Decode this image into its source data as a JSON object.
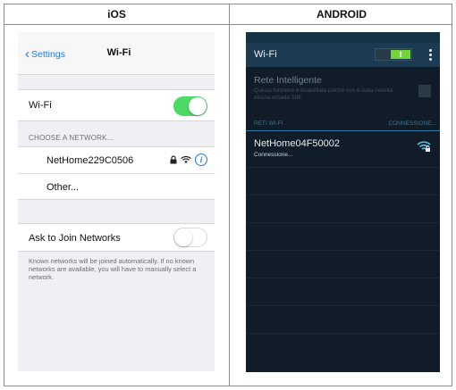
{
  "columns": {
    "ios": "iOS",
    "android": "ANDROID"
  },
  "ios": {
    "nav": {
      "back_label": "Settings",
      "title": "Wi-Fi"
    },
    "wifi_toggle": {
      "label": "Wi-Fi",
      "state": "on"
    },
    "choose_network_header": "CHOOSE A NETWORK...",
    "networks": [
      {
        "name": "NetHome229C0506",
        "icons": [
          "lock-icon",
          "wifi-icon",
          "info-icon"
        ]
      },
      {
        "name": "Other..."
      }
    ],
    "ask_to_join": {
      "label": "Ask to Join Networks",
      "state": "off"
    },
    "footnote": "Known networks will be joined automatically. If no known networks are available, you will have to manually select a network.",
    "info_glyph": "i",
    "colors": {
      "accent": "#1f7ae0",
      "toggle_on": "#4cd964",
      "background": "#efeff4"
    }
  },
  "android": {
    "toolbar": {
      "title": "Wi-Fi",
      "switch_state": "on"
    },
    "smart_network": {
      "title": "Rete Intelligente",
      "description": "Questa funzione è disabilitata poiché non è stata inserita alcuna scheda SIM."
    },
    "section": {
      "left": "RETI WI-FI",
      "right": "CONNESSIONE..."
    },
    "network": {
      "name": "NetHome04F50002",
      "status": "Connessione..."
    },
    "colors": {
      "background": "#101c27",
      "toolbar": "#1c3b52",
      "switch": "#72d63b",
      "section": "#2d7aa9"
    }
  }
}
